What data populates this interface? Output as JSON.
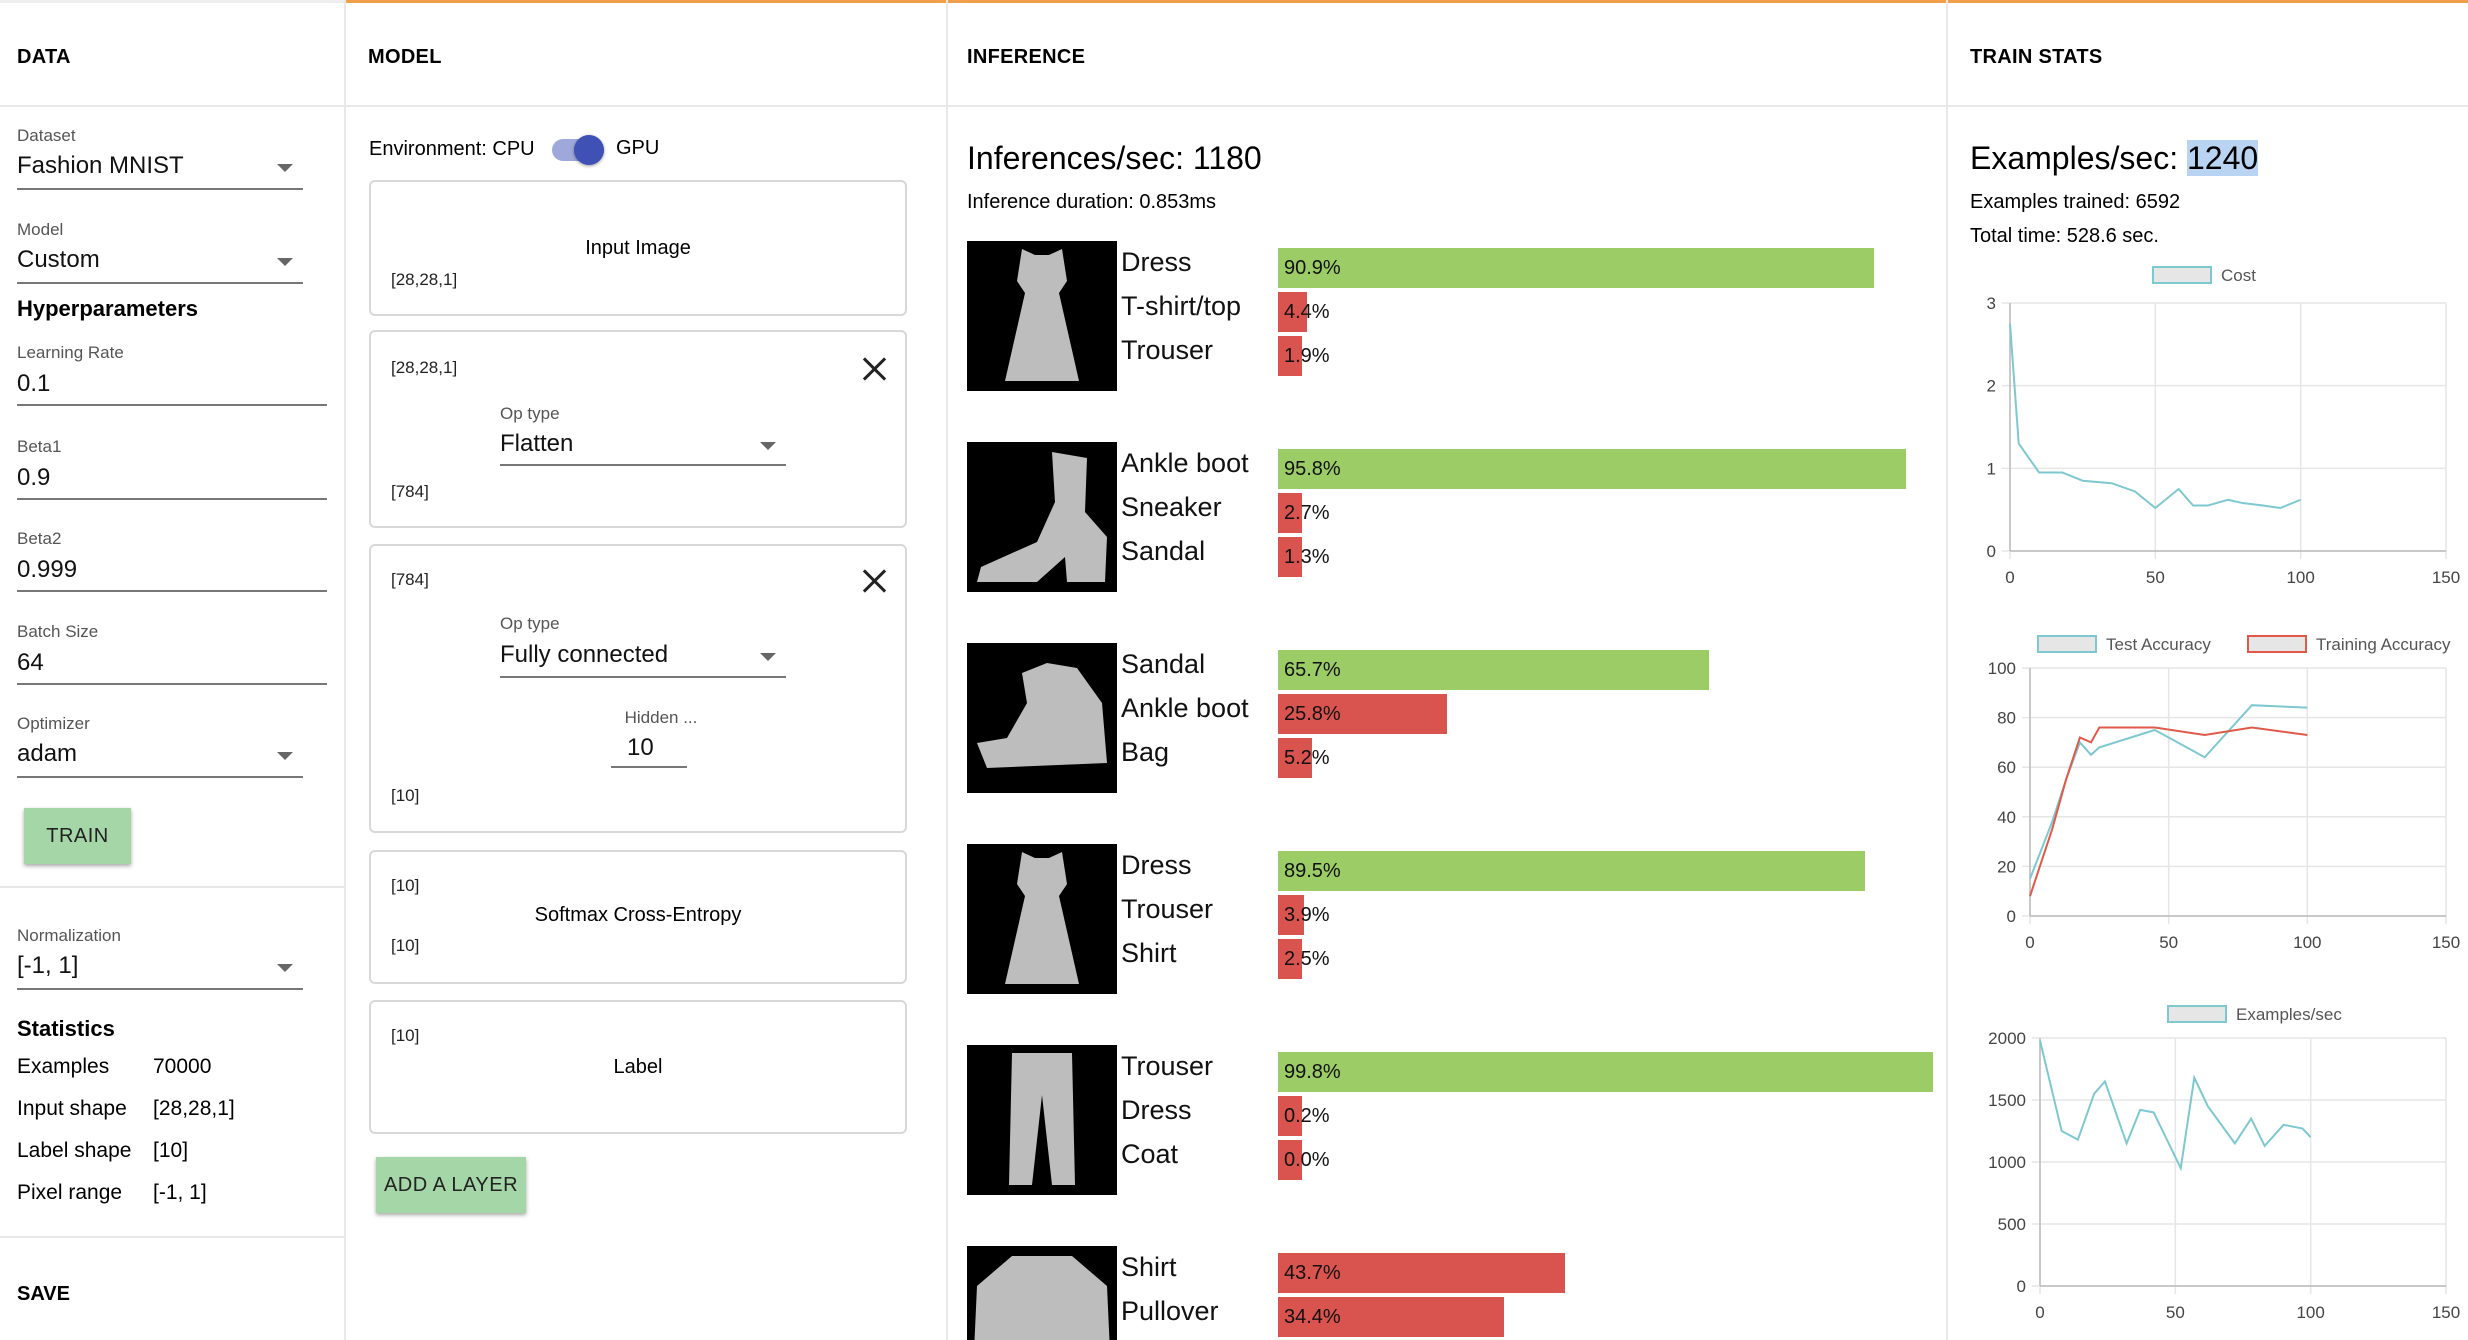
{
  "columns": {
    "data": "DATA",
    "model": "MODEL",
    "inference": "INFERENCE",
    "train_stats": "TRAIN STATS"
  },
  "data_panel": {
    "dataset_label": "Dataset",
    "dataset_value": "Fashion MNIST",
    "model_label": "Model",
    "model_value": "Custom",
    "hyperparameters_title": "Hyperparameters",
    "learning_rate_label": "Learning Rate",
    "learning_rate_value": "0.1",
    "beta1_label": "Beta1",
    "beta1_value": "0.9",
    "beta2_label": "Beta2",
    "beta2_value": "0.999",
    "batch_size_label": "Batch Size",
    "batch_size_value": "64",
    "optimizer_label": "Optimizer",
    "optimizer_value": "adam",
    "train_button": "TRAIN",
    "normalization_label": "Normalization",
    "normalization_value": "[-1, 1]",
    "statistics_title": "Statistics",
    "stats": [
      {
        "key": "Examples",
        "value": "70000"
      },
      {
        "key": "Input shape",
        "value": "[28,28,1]"
      },
      {
        "key": "Label shape",
        "value": "[10]"
      },
      {
        "key": "Pixel range",
        "value": "[-1, 1]"
      }
    ],
    "save_label": "SAVE"
  },
  "model_panel": {
    "environment_label": "Environment: CPU",
    "gpu_label": "GPU",
    "environment_gpu_on": true,
    "layers": [
      {
        "title": "Input Image",
        "out_shape": "[28,28,1]"
      },
      {
        "in_shape": "[28,28,1]",
        "op_type_label": "Op type",
        "op_type_value": "Flatten",
        "out_shape": "[784]"
      },
      {
        "in_shape": "[784]",
        "op_type_label": "Op type",
        "op_type_value": "Fully connected",
        "hidden_label": "Hidden ...",
        "hidden_value": "10",
        "out_shape": "[10]"
      },
      {
        "in_shape": "[10]",
        "title": "Softmax Cross-Entropy",
        "out_shape": "[10]"
      },
      {
        "in_shape": "[10]",
        "title": "Label"
      }
    ],
    "add_layer_button": "ADD A LAYER"
  },
  "inference_panel": {
    "inferences_per_sec": "Inferences/sec: 1180",
    "inference_duration": "Inference duration: 0.853ms",
    "correct_color": "#9ccc65",
    "wrong_color": "#d9534f",
    "samples": [
      {
        "image": "dress",
        "predictions": [
          {
            "label": "Dress",
            "percent": "90.9%",
            "value": 90.9,
            "correct": true
          },
          {
            "label": "T-shirt/top",
            "percent": "4.4%",
            "value": 4.4,
            "correct": false
          },
          {
            "label": "Trouser",
            "percent": "1.9%",
            "value": 1.9,
            "correct": false
          }
        ]
      },
      {
        "image": "ankle-boot",
        "predictions": [
          {
            "label": "Ankle boot",
            "percent": "95.8%",
            "value": 95.8,
            "correct": true
          },
          {
            "label": "Sneaker",
            "percent": "2.7%",
            "value": 2.7,
            "correct": false
          },
          {
            "label": "Sandal",
            "percent": "1.3%",
            "value": 1.3,
            "correct": false
          }
        ]
      },
      {
        "image": "sandal",
        "predictions": [
          {
            "label": "Sandal",
            "percent": "65.7%",
            "value": 65.7,
            "correct": true
          },
          {
            "label": "Ankle boot",
            "percent": "25.8%",
            "value": 25.8,
            "correct": false
          },
          {
            "label": "Bag",
            "percent": "5.2%",
            "value": 5.2,
            "correct": false
          }
        ]
      },
      {
        "image": "dress",
        "predictions": [
          {
            "label": "Dress",
            "percent": "89.5%",
            "value": 89.5,
            "correct": true
          },
          {
            "label": "Trouser",
            "percent": "3.9%",
            "value": 3.9,
            "correct": false
          },
          {
            "label": "Shirt",
            "percent": "2.5%",
            "value": 2.5,
            "correct": false
          }
        ]
      },
      {
        "image": "trouser",
        "predictions": [
          {
            "label": "Trouser",
            "percent": "99.8%",
            "value": 99.8,
            "correct": true
          },
          {
            "label": "Dress",
            "percent": "0.2%",
            "value": 0.2,
            "correct": false
          },
          {
            "label": "Coat",
            "percent": "0.0%",
            "value": 0.0,
            "correct": false
          }
        ]
      },
      {
        "image": "pullover",
        "predictions": [
          {
            "label": "Shirt",
            "percent": "43.7%",
            "value": 43.7,
            "correct": false
          },
          {
            "label": "Pullover",
            "percent": "34.4%",
            "value": 34.4,
            "correct": false
          }
        ]
      }
    ]
  },
  "train_stats": {
    "examples_per_sec_label": "Examples/sec:",
    "examples_per_sec_value": "1240",
    "examples_trained": "Examples trained: 6592",
    "total_time": "Total time: 528.6 sec."
  },
  "chart_data": [
    {
      "type": "line",
      "series": [
        {
          "name": "Cost",
          "color": "#7ec8d0",
          "x": [
            0,
            3,
            10,
            18,
            25,
            35,
            43,
            50,
            58,
            63,
            68,
            75,
            80,
            87,
            93,
            100
          ],
          "y": [
            2.75,
            1.3,
            0.95,
            0.95,
            0.85,
            0.82,
            0.72,
            0.52,
            0.75,
            0.55,
            0.55,
            0.62,
            0.58,
            0.55,
            0.52,
            0.62
          ]
        }
      ],
      "xlim": [
        0,
        150
      ],
      "ylim": [
        0,
        3
      ],
      "xticks": [
        0,
        50,
        100,
        150
      ],
      "yticks": [
        0,
        1,
        2,
        3
      ],
      "grid": true,
      "legend": "top"
    },
    {
      "type": "line",
      "series": [
        {
          "name": "Test Accuracy",
          "color": "#7ec8d0",
          "x": [
            0,
            8,
            13,
            18,
            22,
            25,
            45,
            63,
            80,
            100
          ],
          "y": [
            15,
            38,
            55,
            70,
            65,
            68,
            75,
            64,
            85,
            84
          ]
        },
        {
          "name": "Training Accuracy",
          "color": "#e05a4a",
          "x": [
            0,
            8,
            13,
            18,
            22,
            25,
            45,
            63,
            80,
            100
          ],
          "y": [
            8,
            35,
            55,
            72,
            70,
            76,
            76,
            73,
            76,
            73
          ]
        }
      ],
      "xlim": [
        0,
        150
      ],
      "ylim": [
        0,
        100
      ],
      "xticks": [
        0,
        50,
        100,
        150
      ],
      "yticks": [
        0,
        20,
        40,
        60,
        80,
        100
      ],
      "grid": true,
      "legend": "top"
    },
    {
      "type": "line",
      "series": [
        {
          "name": "Examples/sec",
          "color": "#7ec8d0",
          "x": [
            0,
            8,
            14,
            20,
            24,
            32,
            37,
            42,
            52,
            57,
            62,
            72,
            78,
            83,
            90,
            97,
            100
          ],
          "y": [
            1980,
            1250,
            1180,
            1550,
            1650,
            1150,
            1420,
            1400,
            950,
            1680,
            1450,
            1150,
            1350,
            1130,
            1300,
            1270,
            1200
          ]
        }
      ],
      "xlim": [
        0,
        150
      ],
      "ylim": [
        0,
        2000
      ],
      "xticks": [
        0,
        50,
        100,
        150
      ],
      "yticks": [
        0,
        500,
        1000,
        1500,
        2000
      ],
      "grid": true,
      "legend": "top"
    }
  ]
}
